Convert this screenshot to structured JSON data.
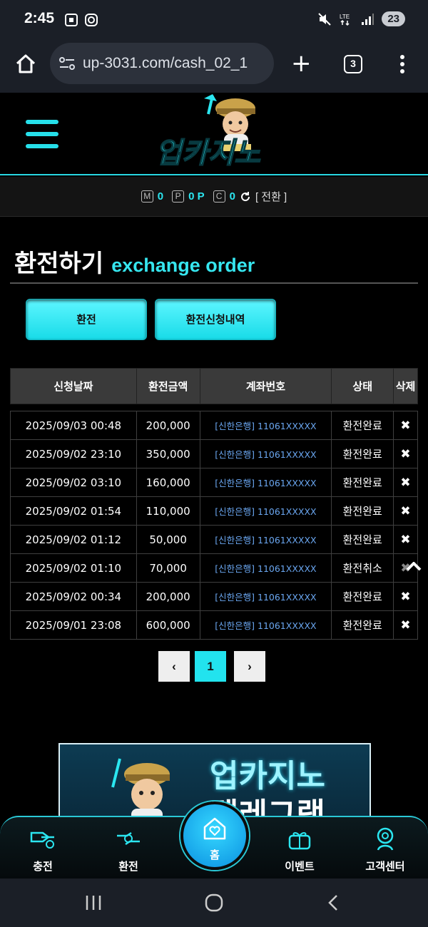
{
  "status_bar": {
    "time": "2:45",
    "battery": "23"
  },
  "browser": {
    "url": "up-3031.com/cash_02_1",
    "tab_count": "3"
  },
  "site": {
    "logo_text": "업카지노"
  },
  "points": {
    "money_icon": "M",
    "money_value": "0",
    "point_icon": "P",
    "point_value": "0 P",
    "coin_icon": "C",
    "coin_value": "0",
    "exchange_label": "[ 전환 ]"
  },
  "page": {
    "title_ko": "환전하기",
    "title_en": "exchange order"
  },
  "tabs": {
    "exchange": "환전",
    "history": "환전신청내역"
  },
  "table": {
    "headers": [
      "신청날짜",
      "환전금액",
      "계좌번호",
      "상태",
      "삭제"
    ],
    "rows": [
      {
        "date": "2025/09/03 00:48",
        "amount": "200,000",
        "account": "[신한은행] 11061XXXXX",
        "status": "환전완료",
        "delete": "✖"
      },
      {
        "date": "2025/09/02 23:10",
        "amount": "350,000",
        "account": "[신한은행] 11061XXXXX",
        "status": "환전완료",
        "delete": "✖"
      },
      {
        "date": "2025/09/02 03:10",
        "amount": "160,000",
        "account": "[신한은행] 11061XXXXX",
        "status": "환전완료",
        "delete": "✖"
      },
      {
        "date": "2025/09/02 01:54",
        "amount": "110,000",
        "account": "[신한은행] 11061XXXXX",
        "status": "환전완료",
        "delete": "✖"
      },
      {
        "date": "2025/09/02 01:12",
        "amount": "50,000",
        "account": "[신한은행] 11061XXXXX",
        "status": "환전완료",
        "delete": "✖"
      },
      {
        "date": "2025/09/02 01:10",
        "amount": "70,000",
        "account": "[신한은행] 11061XXXXX",
        "status": "환전취소",
        "delete": "✖"
      },
      {
        "date": "2025/09/02 00:34",
        "amount": "200,000",
        "account": "[신한은행] 11061XXXXX",
        "status": "환전완료",
        "delete": "✖"
      },
      {
        "date": "2025/09/01 23:08",
        "amount": "600,000",
        "account": "[신한은행] 11061XXXXX",
        "status": "환전완료",
        "delete": "✖"
      }
    ]
  },
  "pagination": {
    "prev": "‹",
    "current": "1",
    "next": "›"
  },
  "banner": {
    "line1": "업카지노",
    "line2": "텔레그램"
  },
  "bottom_nav": {
    "deposit": "충전",
    "withdraw": "환전",
    "home": "홈",
    "event": "이벤트",
    "support": "고객센터"
  },
  "colors": {
    "accent": "#26e0ea",
    "status_bar_bg": "#1b1f27",
    "account_text": "#6aa6f0"
  }
}
